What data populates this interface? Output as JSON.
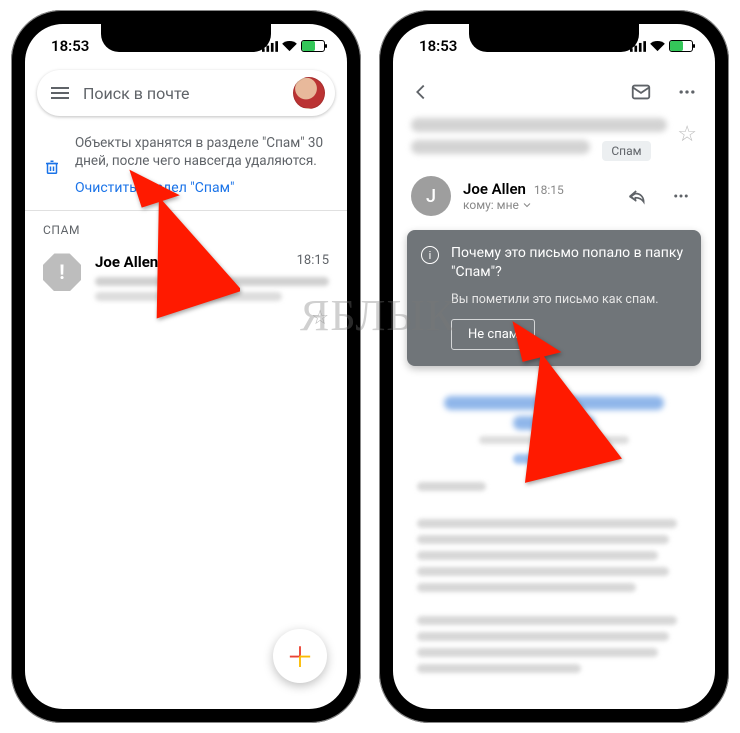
{
  "status": {
    "time": "18:53"
  },
  "left": {
    "search_placeholder": "Поиск в почте",
    "banner_info": "Объекты хранятся в разделе \"Спам\" 30 дней, после чего навсегда удаляются.",
    "banner_link": "Очистить раздел \"Спам\"",
    "section": "СПАМ",
    "mail": {
      "sender": "Joe Allen",
      "time": "18:15"
    }
  },
  "right": {
    "chip": "Спам",
    "sender": {
      "name": "Joe Allen",
      "initial": "J",
      "time": "18:15",
      "to_label": "кому: мне"
    },
    "spam": {
      "title": "Почему это письмо попало в папку \"Спам\"?",
      "sub": "Вы пометили это письмо как спам.",
      "button": "Не спам"
    }
  },
  "watermark": "ЯБЛЫК"
}
